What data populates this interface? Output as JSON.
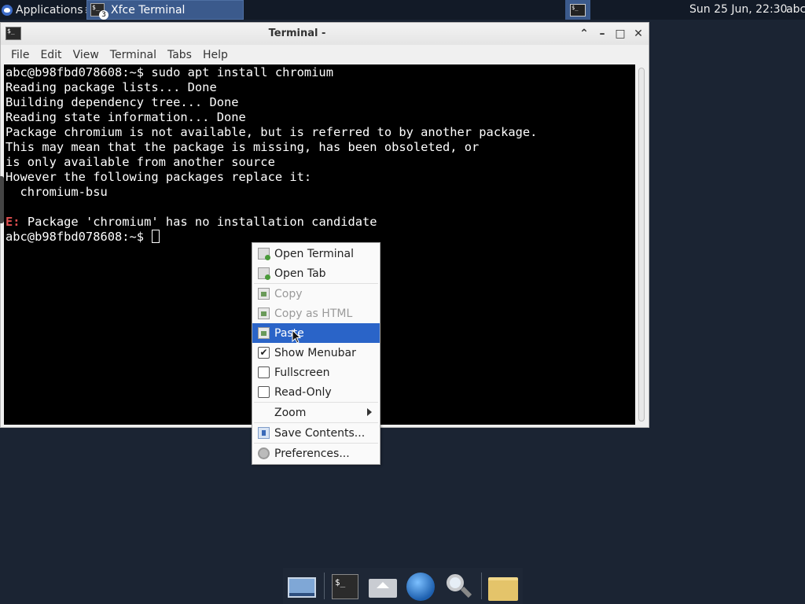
{
  "top_panel": {
    "applications_label": "Applications",
    "task_title": "Xfce Terminal",
    "task_badge": "3",
    "clock": "Sun 25 Jun, 22:30",
    "user": "abc"
  },
  "window": {
    "title": "Terminal -",
    "menubar": [
      "File",
      "Edit",
      "View",
      "Terminal",
      "Tabs",
      "Help"
    ]
  },
  "terminal": {
    "lines": [
      "abc@b98fbd078608:~$ sudo apt install chromium",
      "Reading package lists... Done",
      "Building dependency tree... Done",
      "Reading state information... Done",
      "Package chromium is not available, but is referred to by another package.",
      "This may mean that the package is missing, has been obsoleted, or",
      "is only available from another source",
      "However the following packages replace it:",
      "  chromium-bsu",
      ""
    ],
    "error_prefix": "E:",
    "error_text": " Package 'chromium' has no installation candidate",
    "prompt": "abc@b98fbd078608:~$ "
  },
  "context_menu": {
    "items": [
      {
        "label": "Open Terminal",
        "icon": "terminal-icon"
      },
      {
        "label": "Open Tab",
        "icon": "terminal-tab-icon"
      },
      {
        "label": "Copy",
        "icon": "copy-icon",
        "disabled": true
      },
      {
        "label": "Copy as HTML",
        "icon": "copy-html-icon",
        "disabled": true
      },
      {
        "label": "Paste",
        "icon": "paste-icon",
        "active": true
      },
      {
        "label": "Show Menubar",
        "checked": true
      },
      {
        "label": "Fullscreen",
        "checked": false
      },
      {
        "label": "Read-Only",
        "checked": false
      },
      {
        "label": "Zoom",
        "submenu": true
      },
      {
        "label": "Save Contents...",
        "icon": "save-icon"
      },
      {
        "label": "Preferences...",
        "icon": "gear-icon"
      }
    ],
    "check_mark": "✔"
  },
  "dock": {
    "terminal_glyph": "$_"
  },
  "colors": {
    "desktop": "#1b2433",
    "panel": "#121a27",
    "selection": "#2a64c8",
    "error": "#e05050"
  }
}
